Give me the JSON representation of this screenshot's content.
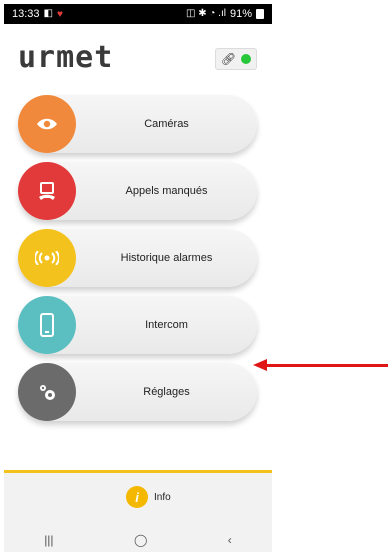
{
  "status": {
    "time": "13:33",
    "left_icons": "◧",
    "right_icons": "◫ ✱ ◔ .ıl",
    "battery": "91%"
  },
  "header": {
    "logo": "urmet"
  },
  "menu": [
    {
      "label": "Caméras",
      "icon": "eye-icon",
      "color": "#f0893b"
    },
    {
      "label": "Appels manqués",
      "icon": "missed-call-icon",
      "color": "#e23a3a"
    },
    {
      "label": "Historique alarmes",
      "icon": "alarm-signal-icon",
      "color": "#f4c21d"
    },
    {
      "label": "Intercom",
      "icon": "phone-device-icon",
      "color": "#5bbfc2"
    },
    {
      "label": "Réglages",
      "icon": "gears-icon",
      "color": "#6b6b6b"
    }
  ],
  "footer": {
    "info_label": "Info"
  },
  "nav": {
    "recents": "|||",
    "home": "◯",
    "back": "‹"
  },
  "colors": {
    "footer_accent": "#f4c21d",
    "arrow": "#e01616",
    "connected": "#27c73a"
  }
}
